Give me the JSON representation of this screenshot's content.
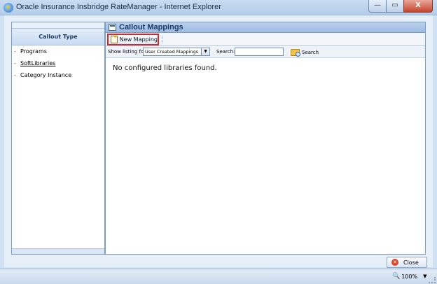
{
  "window": {
    "title": "Oracle Insurance Insbridge RateManager - Internet Explorer",
    "ie_icon": "e",
    "min": "—",
    "max": "▭",
    "close": "X"
  },
  "left_panel": {
    "header": "Callout Type",
    "items": [
      {
        "label": "Programs"
      },
      {
        "label": "SoftLibraries"
      },
      {
        "label": "Category Instance"
      }
    ],
    "dash": "-"
  },
  "right_panel": {
    "title": "Callout Mappings",
    "new_mapping_label": "New Mapping",
    "show_listing_label": "Show listing for:",
    "listing_selected": "User Created Mappings",
    "select_arrow": "▼",
    "search_label": "Search:",
    "search_value": "",
    "search_button_label": "Search",
    "empty_message": "No configured libraries found."
  },
  "footer": {
    "close_label": "Close",
    "close_glyph": "✕"
  },
  "statusbar": {
    "zoom_icon": "🔍",
    "zoom": "100%",
    "zoom_arrow": "▼"
  },
  "colors": {
    "accent_red": "#d62828",
    "header_blue": "#9dbce3"
  }
}
